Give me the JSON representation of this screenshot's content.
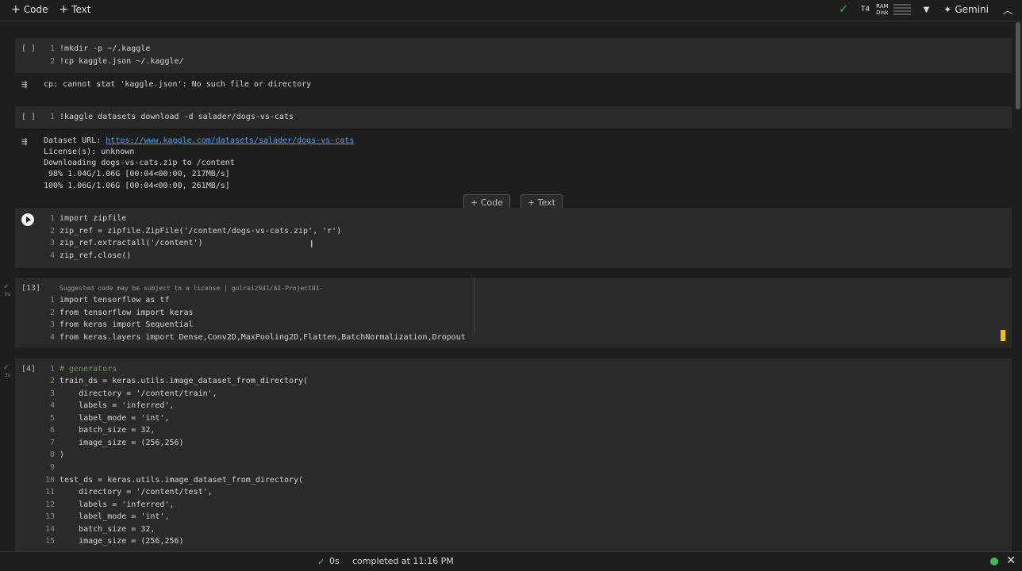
{
  "toolbar": {
    "code_label": "Code",
    "text_label": "Text",
    "t4": "T4",
    "ram": "RAM",
    "disk": "Disk",
    "gemini": "Gemini"
  },
  "cells": [
    {
      "bracket": "[ ]",
      "lines": [
        "!mkdir -p ~/.kaggle",
        "!cp kaggle.json ~/.kaggle/"
      ],
      "output": [
        "cp: cannot stat 'kaggle.json': No such file or directory"
      ]
    },
    {
      "bracket": "[ ]",
      "lines": [
        "!kaggle datasets download -d salader/dogs-vs-cats"
      ],
      "output_url_label": "Dataset URL: ",
      "output_url": "https://www.kaggle.com/datasets/salader/dogs-vs-cats",
      "output": [
        "License(s): unknown",
        "Downloading dogs-vs-cats.zip to /content",
        " 98% 1.04G/1.06G [00:04<00:00, 217MB/s]",
        "100% 1.06G/1.06G [00:04<00:00, 261MB/s]"
      ]
    },
    {
      "lines": [
        "import zipfile",
        "zip_ref = zipfile.ZipFile('/content/dogs-vs-cats.zip', 'r')",
        "zip_ref.extractall('/content')",
        "zip_ref.close()"
      ]
    },
    {
      "bracket": "[13]",
      "suggestion": "Suggested code may be subject to a license | gulraiz941/AI-Project01-",
      "lines": [
        "import tensorflow as tf",
        "from tensorflow import keras",
        "from keras import Sequential",
        "from keras.layers import Dense,Conv2D,MaxPooling2D,Flatten,BatchNormalization,Dropout"
      ],
      "time": "0s"
    },
    {
      "bracket": "[4]",
      "lines": [
        "# generators",
        "train_ds = keras.utils.image_dataset_from_directory(",
        "    directory = '/content/train',",
        "    labels = 'inferred',",
        "    label_mode = 'int',",
        "    batch_size = 32,",
        "    image_size = (256,256)",
        ")",
        "",
        "test_ds = keras.utils.image_dataset_from_directory(",
        "    directory = '/content/test',",
        "    labels = 'inferred',",
        "    label_mode = 'int',",
        "    batch_size = 32,",
        "    image_size = (256,256)"
      ],
      "time": "3s"
    }
  ],
  "add_buttons": {
    "code": "Code",
    "text": "Text"
  },
  "status": {
    "time": "0s",
    "completed": "completed at 11:16 PM"
  }
}
